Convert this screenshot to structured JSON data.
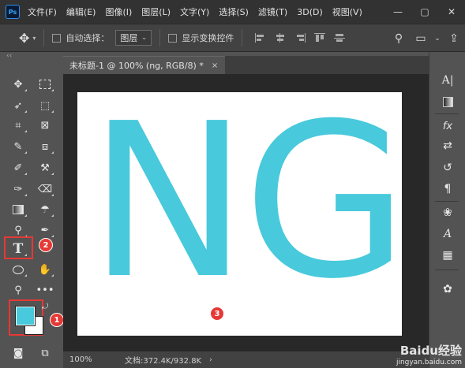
{
  "app": {
    "logo": "Ps"
  },
  "menu": {
    "items": [
      "文件(F)",
      "编辑(E)",
      "图像(I)",
      "图层(L)",
      "文字(Y)",
      "选择(S)",
      "滤镜(T)",
      "3D(D)",
      "视图(V)"
    ]
  },
  "window_controls": {
    "minimize": "—",
    "maximize": "▢",
    "close": "✕"
  },
  "options_bar": {
    "auto_select_label": "自动选择：",
    "auto_select_checked": false,
    "target_value": "图层",
    "show_transform_label": "显示变换控件",
    "show_transform_checked": false
  },
  "document": {
    "tab_title": "未标题-1 @ 100% (ng, RGB/8) *",
    "close_glyph": "×",
    "canvas_text": "NG",
    "text_color": "#48c9dc"
  },
  "status_bar": {
    "zoom": "100%",
    "doc_size": "文档:372.4K/932.8K"
  },
  "colors": {
    "foreground": "#48c9dc",
    "background": "#ffffff",
    "highlight": "#e53935"
  },
  "annotations": {
    "badge_1": "1",
    "badge_2": "2",
    "badge_3": "3"
  },
  "watermark": {
    "logo": "Baidu经验",
    "url": "jingyan.baidu.com"
  },
  "collapse": {
    "left": "‹‹",
    "right": "››"
  }
}
